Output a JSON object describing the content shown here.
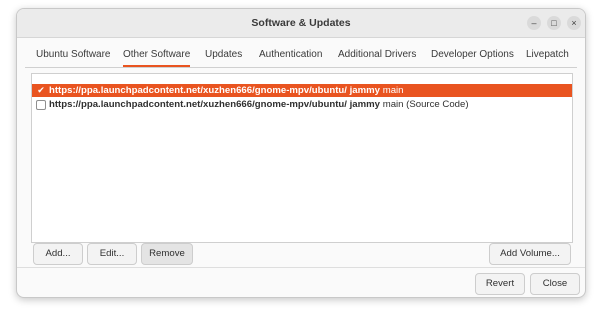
{
  "window": {
    "title": "Software & Updates",
    "controls": {
      "minimize": "–",
      "maximize": "□",
      "close": "×"
    }
  },
  "tabs": [
    {
      "label": "Ubuntu Software",
      "active": false
    },
    {
      "label": "Other Software",
      "active": true
    },
    {
      "label": "Updates",
      "active": false
    },
    {
      "label": "Authentication",
      "active": false
    },
    {
      "label": "Additional Drivers",
      "active": false
    },
    {
      "label": "Developer Options",
      "active": false
    },
    {
      "label": "Livepatch",
      "active": false
    }
  ],
  "sources": [
    {
      "checked": true,
      "selected": true,
      "url": "https://ppa.launchpadcontent.net/xuzhen666/gnome-mpv/ubuntu/",
      "dist": "jammy",
      "component": "main"
    },
    {
      "checked": false,
      "selected": false,
      "url": "https://ppa.launchpadcontent.net/xuzhen666/gnome-mpv/ubuntu/",
      "dist": "jammy",
      "component": "main (Source Code)"
    }
  ],
  "buttons": {
    "add": "Add...",
    "edit": "Edit...",
    "remove": "Remove",
    "add_volume": "Add Volume...",
    "revert": "Revert",
    "close": "Close"
  },
  "colors": {
    "accent": "#e95420"
  }
}
